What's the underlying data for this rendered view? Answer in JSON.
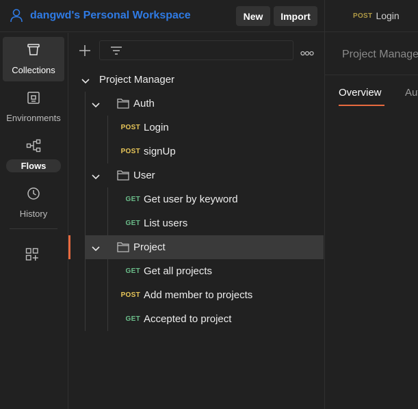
{
  "header": {
    "workspace_title": "dangwd's Personal Workspace",
    "new_label": "New",
    "import_label": "Import"
  },
  "right_pane": {
    "request_tab": {
      "method": "POST",
      "name": "Login"
    },
    "breadcrumb": "Project Manager",
    "tabs": [
      "Overview",
      "Auth"
    ]
  },
  "rail": {
    "items": [
      {
        "label": "Collections",
        "icon": "collections-icon",
        "active": true
      },
      {
        "label": "Environments",
        "icon": "environments-icon"
      },
      {
        "label": "Flows",
        "icon": "flows-icon"
      },
      {
        "label": "History",
        "icon": "history-icon"
      }
    ],
    "add_icon": "add-workbench-icon"
  },
  "tree": {
    "collection": "Project Manager",
    "folders": [
      {
        "name": "Auth",
        "requests": [
          {
            "method": "POST",
            "name": "Login"
          },
          {
            "method": "POST",
            "name": "signUp"
          }
        ]
      },
      {
        "name": "User",
        "requests": [
          {
            "method": "GET",
            "name": "Get user by keyword"
          },
          {
            "method": "GET",
            "name": "List users"
          }
        ]
      },
      {
        "name": "Project",
        "requests": [
          {
            "method": "GET",
            "name": "Get all projects"
          },
          {
            "method": "POST",
            "name": "Add member to projects"
          },
          {
            "method": "GET",
            "name": "Accepted to project"
          }
        ]
      }
    ]
  },
  "colors": {
    "accent": "#e86a3f",
    "workspace_blue": "#2f7be5",
    "post": "#e8c659",
    "get": "#6bbd8a"
  }
}
